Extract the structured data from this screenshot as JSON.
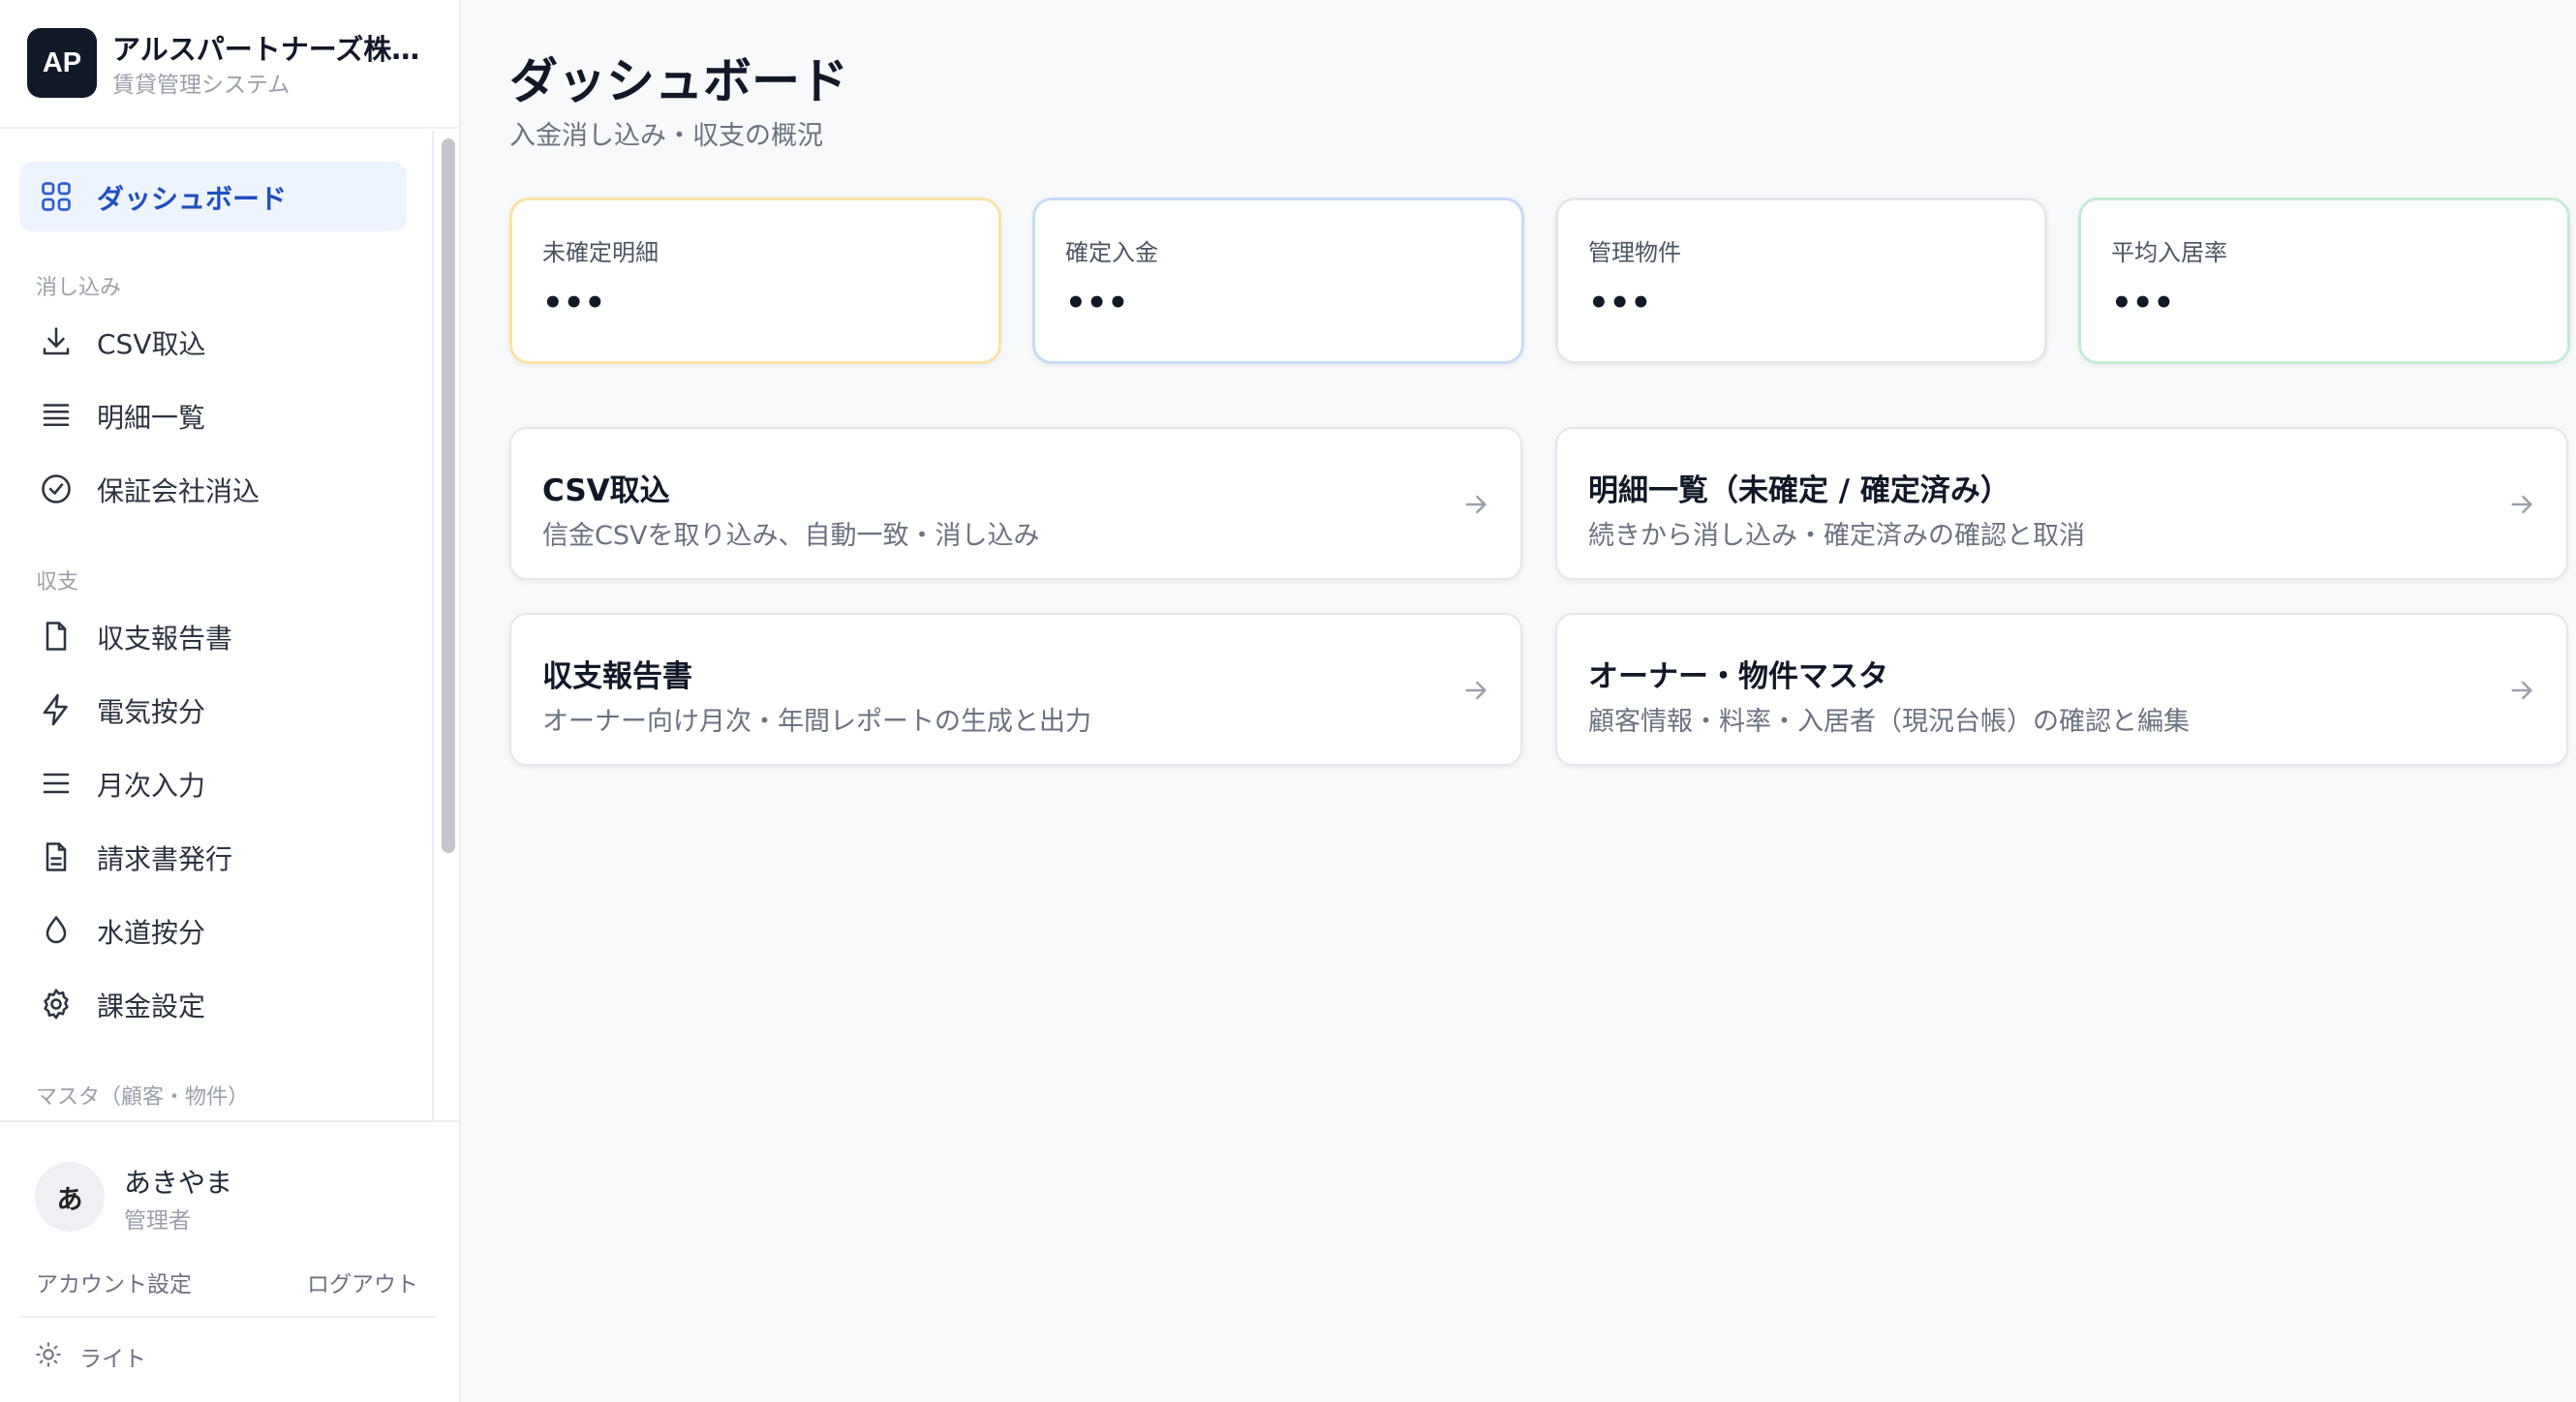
{
  "brand": {
    "logo_text": "AP",
    "name": "アルスパートナーズ株...",
    "subtitle": "賃貸管理システム"
  },
  "sidebar": {
    "items": [
      {
        "label": "ダッシュボード",
        "icon": "grid-icon",
        "active": true
      },
      {
        "label": "CSV取込",
        "icon": "download-icon"
      },
      {
        "label": "明細一覧",
        "icon": "list-icon"
      },
      {
        "label": "保証会社消込",
        "icon": "check-circle-icon"
      },
      {
        "label": "収支報告書",
        "icon": "file-icon"
      },
      {
        "label": "電気按分",
        "icon": "lightning-icon"
      },
      {
        "label": "月次入力",
        "icon": "menu-icon"
      },
      {
        "label": "請求書発行",
        "icon": "file-text-icon"
      },
      {
        "label": "水道按分",
        "icon": "droplet-icon"
      },
      {
        "label": "課金設定",
        "icon": "gear-icon"
      }
    ],
    "sections": {
      "reconcile": "消し込み",
      "finance": "収支",
      "master": "マスタ（顧客・物件）"
    }
  },
  "user": {
    "avatar_text": "あ",
    "name": "あきやま",
    "role": "管理者",
    "account_settings": "アカウント設定",
    "logout": "ログアウト",
    "theme_label": "ライト"
  },
  "page": {
    "title": "ダッシュボード",
    "subtitle": "入金消し込み・収支の概況"
  },
  "stats": [
    {
      "label": "未確定明細",
      "value": "•••",
      "accent": "#f8e3a4"
    },
    {
      "label": "確定入金",
      "value": "•••",
      "accent": "#c6dbf6"
    },
    {
      "label": "管理物件",
      "value": "•••",
      "accent": "#e5e7eb"
    },
    {
      "label": "平均入居率",
      "value": "•••",
      "accent": "#c4ecd2"
    }
  ],
  "cards": [
    {
      "title": "CSV取込",
      "description": "信金CSVを取り込み、自動一致・消し込み"
    },
    {
      "title": "明細一覧（未確定 / 確定済み）",
      "description": "続きから消し込み・確定済みの確認と取消"
    },
    {
      "title": "収支報告書",
      "description": "オーナー向け月次・年間レポートの生成と出力"
    },
    {
      "title": "オーナー・物件マスタ",
      "description": "顧客情報・料率・入居者（現況台帳）の確認と編集"
    }
  ],
  "colors": {
    "active_nav_bg": "#eef4fe",
    "active_nav_text": "#1f4fbf",
    "logo_bg": "#111827"
  }
}
